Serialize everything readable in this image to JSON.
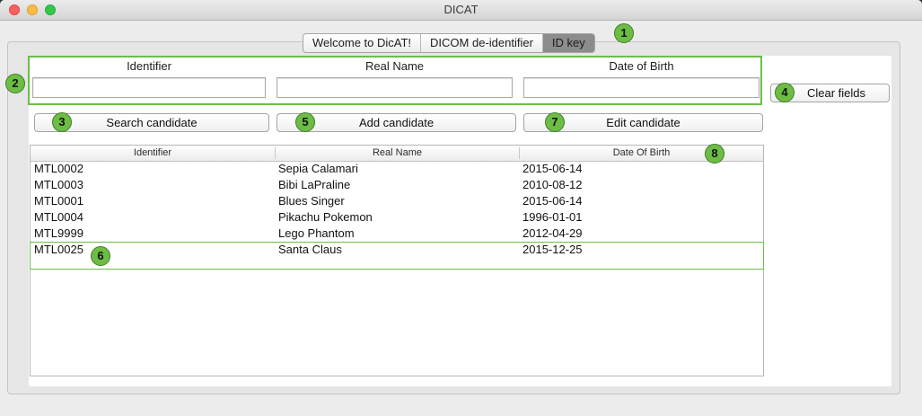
{
  "window": {
    "title": "DICAT"
  },
  "tabs": [
    {
      "label": "Welcome to DicAT!"
    },
    {
      "label": "DICOM de-identifier"
    },
    {
      "label": "ID key"
    }
  ],
  "form": {
    "identifier_label": "Identifier",
    "realname_label": "Real Name",
    "dob_label": "Date of Birth",
    "identifier_value": "",
    "realname_value": "",
    "dob_value": ""
  },
  "buttons": {
    "clear": "Clear fields",
    "search": "Search candidate",
    "add": "Add candidate",
    "edit": "Edit candidate"
  },
  "table": {
    "columns": [
      "Identifier",
      "Real Name",
      "Date Of Birth"
    ],
    "rows": [
      {
        "id": "MTL0002",
        "name": "Sepia Calamari",
        "dob": "2015-06-14"
      },
      {
        "id": "MTL0003",
        "name": "Bibi LaPraline",
        "dob": "2010-08-12"
      },
      {
        "id": "MTL0001",
        "name": "Blues Singer",
        "dob": "2015-06-14"
      },
      {
        "id": "MTL0004",
        "name": "Pikachu Pokemon",
        "dob": "1996-01-01"
      },
      {
        "id": "MTL9999",
        "name": "Lego Phantom",
        "dob": "2012-04-29"
      },
      {
        "id": "MTL0025",
        "name": "Santa Claus",
        "dob": "2015-12-25"
      }
    ]
  },
  "annotations": [
    "1",
    "2",
    "3",
    "4",
    "5",
    "6",
    "7",
    "8"
  ],
  "colors": {
    "annotation": "#6dbd45",
    "highlight_border": "#6bbf47",
    "active_tab": "#8c8c8c"
  }
}
